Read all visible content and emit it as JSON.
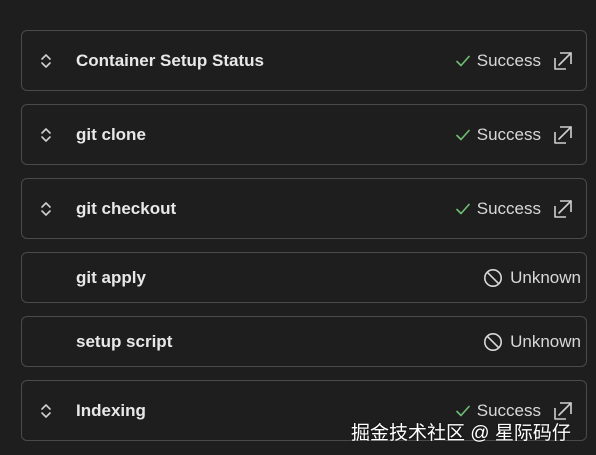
{
  "steps": [
    {
      "title": "Container Setup Status",
      "status": "Success",
      "expandable": true
    },
    {
      "title": "git clone",
      "status": "Success",
      "expandable": true
    },
    {
      "title": "git checkout",
      "status": "Success",
      "expandable": true
    },
    {
      "title": "git apply",
      "status": "Unknown",
      "expandable": false
    },
    {
      "title": "setup script",
      "status": "Unknown",
      "expandable": false
    },
    {
      "title": "Indexing",
      "status": "Success",
      "expandable": true
    }
  ],
  "watermark": "掘金技术社区 @ 星际码仔",
  "colors": {
    "background": "#1e1e1e",
    "border": "#4a4a4a",
    "success_check": "#6fbf73",
    "text": "#e6e6e6"
  },
  "icons": {
    "expand": "chevron-up-down-icon",
    "success": "check-icon",
    "unknown": "ban-icon",
    "open": "open-external-icon"
  }
}
